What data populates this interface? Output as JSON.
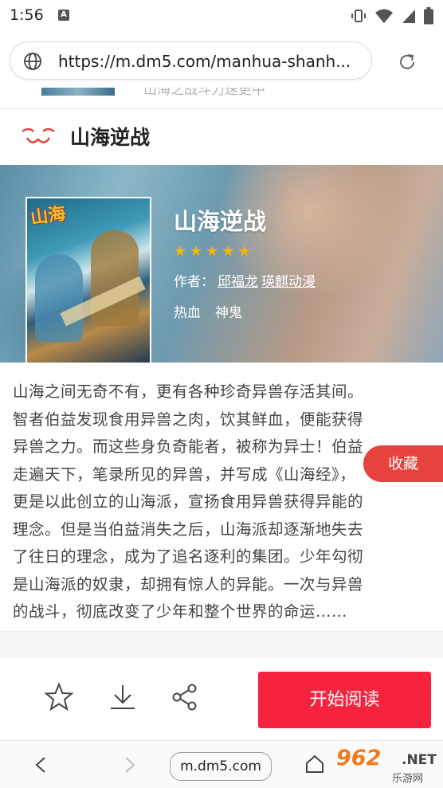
{
  "status_bar": {
    "time": "1:56",
    "notif_letter": "A"
  },
  "browser": {
    "url": "https://m.dm5.com/manhua-shanh...",
    "domain_pill": "m.dm5.com"
  },
  "scrolled_strip": {
    "ghost_text": "山海之战斗力速更中"
  },
  "page": {
    "title": "山海逆战"
  },
  "comic": {
    "title": "山海逆战",
    "cover_title": "山海",
    "rating_stars": 5,
    "author_label": "作者：",
    "authors": [
      "邱福龙",
      "瑛麒动漫"
    ],
    "tags": [
      "热血",
      "神鬼"
    ]
  },
  "description_lines": [
    "山海之间无奇不有，更有各种珍奇异兽存活其间。",
    "智者伯益发现食用异兽之肉，饮其鲜血，便能获得",
    "异兽之力。而这些身负奇能者，被称为异士！伯益",
    "走遍天下，笔录所见的异兽，并写成《山海经》，",
    "更是以此创立的山海派，宣扬食用异兽获得异能的",
    "理念。但是当伯益消失之后，山海派却逐渐地失去",
    "了往日的理念，成为了追名逐利的集团。少年勾彻",
    "是山海派的奴隶，却拥有惊人的异能。一次与异兽",
    "的战斗，彻底改变了少年和整个世界的命运……"
  ],
  "collect_label": "收藏",
  "actions": {
    "read_label": "开始阅读"
  },
  "watermark": {
    "num": "962",
    "net": ".NET",
    "sub": "乐游网"
  },
  "colors": {
    "accent_red": "#f5233e",
    "collect_red": "#e8423e",
    "star": "#f5b800"
  }
}
